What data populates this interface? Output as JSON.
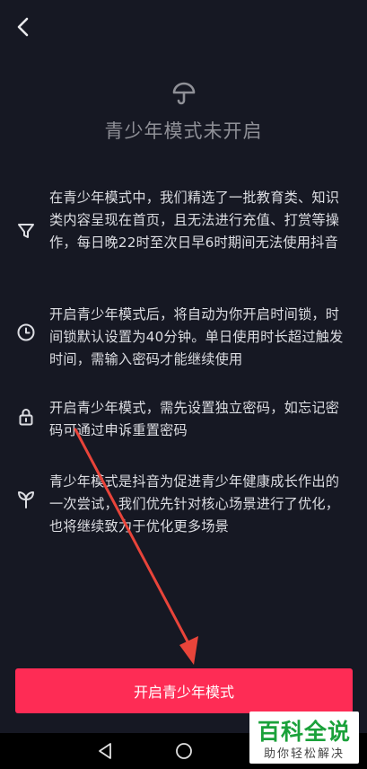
{
  "header": {
    "back_icon": "chevron-left-icon"
  },
  "hero": {
    "icon": "umbrella-icon",
    "title": "青少年模式未开启"
  },
  "features": [
    {
      "icon": "filter-icon",
      "text": "在青少年模式中，我们精选了一批教育类、知识类内容呈现在首页，且无法进行充值、打赏等操作，每日晚22时至次日早6时期间无法使用抖音"
    },
    {
      "icon": "clock-icon",
      "text": "开启青少年模式后，将自动为你开启时间锁，时间锁默认设置为40分钟。单日使用时长超过触发时间，需输入密码才能继续使用"
    },
    {
      "icon": "lock-icon",
      "text": "开启青少年模式，需先设置独立密码，如忘记密码可通过申诉重置密码"
    },
    {
      "icon": "sprout-icon",
      "text": "青少年模式是抖音为促进青少年健康成长作出的一次尝试，我们优先针对核心场景进行了优化，也将继续致力于优化更多场景"
    }
  ],
  "cta": {
    "label": "开启青少年模式"
  },
  "watermark": {
    "main": "百科全说",
    "sub": "助你轻松解决"
  },
  "colors": {
    "background": "#161823",
    "accent": "#fe2c55",
    "annotation": "#e8443a"
  }
}
